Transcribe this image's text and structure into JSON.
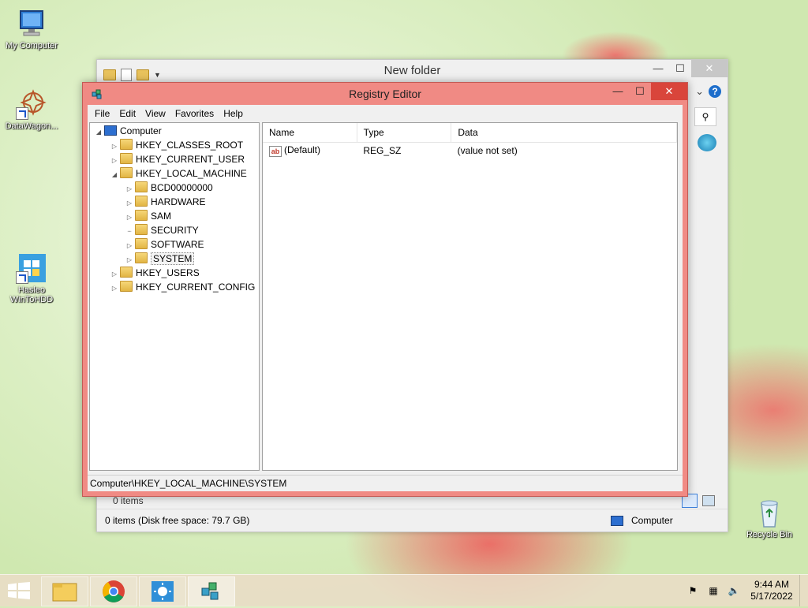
{
  "desktop": {
    "icons": [
      {
        "label": "My Computer"
      },
      {
        "label": "DataWagon..."
      },
      {
        "label": "Hasleo WinToHDD"
      },
      {
        "label": "Recycle Bin"
      }
    ]
  },
  "explorer": {
    "title": "New folder",
    "items_count": "0 items",
    "status_left": "0 items (Disk free space: 79.7 GB)",
    "status_right": "Computer"
  },
  "regedit": {
    "title": "Registry Editor",
    "menu": [
      "File",
      "Edit",
      "View",
      "Favorites",
      "Help"
    ],
    "tree": {
      "root": "Computer",
      "hives": [
        "HKEY_CLASSES_ROOT",
        "HKEY_CURRENT_USER",
        "HKEY_LOCAL_MACHINE"
      ],
      "hklm_children": [
        "BCD00000000",
        "HARDWARE",
        "SAM",
        "SECURITY",
        "SOFTWARE",
        "SYSTEM"
      ],
      "hives_after": [
        "HKEY_USERS",
        "HKEY_CURRENT_CONFIG"
      ]
    },
    "columns": [
      "Name",
      "Type",
      "Data"
    ],
    "rows": [
      {
        "name": "(Default)",
        "type": "REG_SZ",
        "data": "(value not set)"
      }
    ],
    "statusbar": "Computer\\HKEY_LOCAL_MACHINE\\SYSTEM"
  },
  "taskbar": {
    "time": "9:44 AM",
    "date": "5/17/2022"
  }
}
